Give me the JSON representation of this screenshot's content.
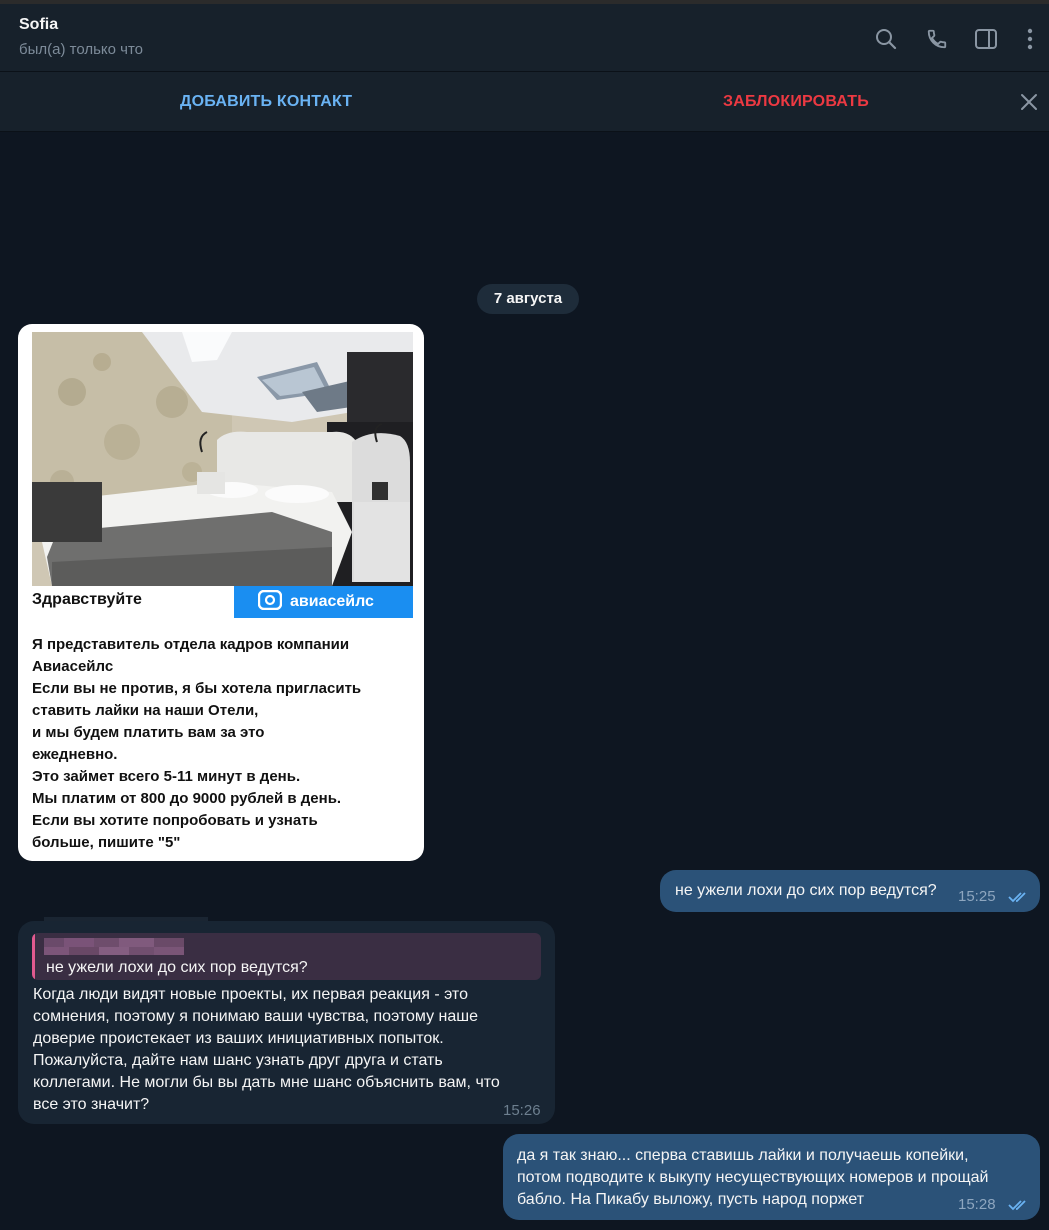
{
  "header": {
    "name": "Sofia",
    "status": "был(а) только что",
    "icons": [
      "search-icon",
      "phone-icon",
      "sidebar-icon",
      "more-icon"
    ]
  },
  "actions": {
    "add_contact": "ДОБАВИТЬ КОНТАКТ",
    "block": "ЗАБЛОКИРОВАТЬ",
    "close_icon": "close-icon"
  },
  "date_label": "7 августа",
  "card": {
    "greeting": "Здравствуйте",
    "brand": "авиасейлс",
    "lines": [
      "Я представитель отдела кадров компании",
      "Авиасейлс",
      "Если вы не против, я бы хотела пригласить",
      "ставить лайки на наши Отели,",
      "и мы будем платить вам за это",
      "ежедневно.",
      "Это займет всего  5-11 минут в день.",
      "Мы платим от 800 до 9000 рублей в день.",
      "Если вы хотите попробовать и узнать",
      "больше, пишите \"5\""
    ]
  },
  "messages": {
    "out1": {
      "text": "не ужели лохи до сих пор ведутся?",
      "time": "15:25"
    },
    "in1": {
      "reply_text": "не ужели лохи до сих пор ведутся?",
      "lines": [
        "Когда люди видят новые проекты, их первая реакция - это",
        "сомнения, поэтому я понимаю ваши чувства, поэтому наше",
        "доверие проистекает из ваших инициативных попыток.",
        "Пожалуйста, дайте нам шанс узнать друг друга и стать",
        "коллегами. Не могли бы вы дать мне шанс объяснить вам, что",
        "все это значит?"
      ],
      "time": "15:26"
    },
    "out2": {
      "lines": [
        "да я так знаю...  сперва ставишь лайки и получаешь копейки,",
        "потом подводите к выкупу несуществующих номеров и прощай",
        "бабло.  На Пикабу выложу,  пусть народ поржет"
      ],
      "time": "15:28"
    }
  },
  "colors": {
    "background": "#0e1621",
    "panel": "#17212b",
    "outgoing": "#2b5278",
    "incoming": "#182533",
    "accent": "#6ab3f3",
    "danger": "#ec3942"
  }
}
